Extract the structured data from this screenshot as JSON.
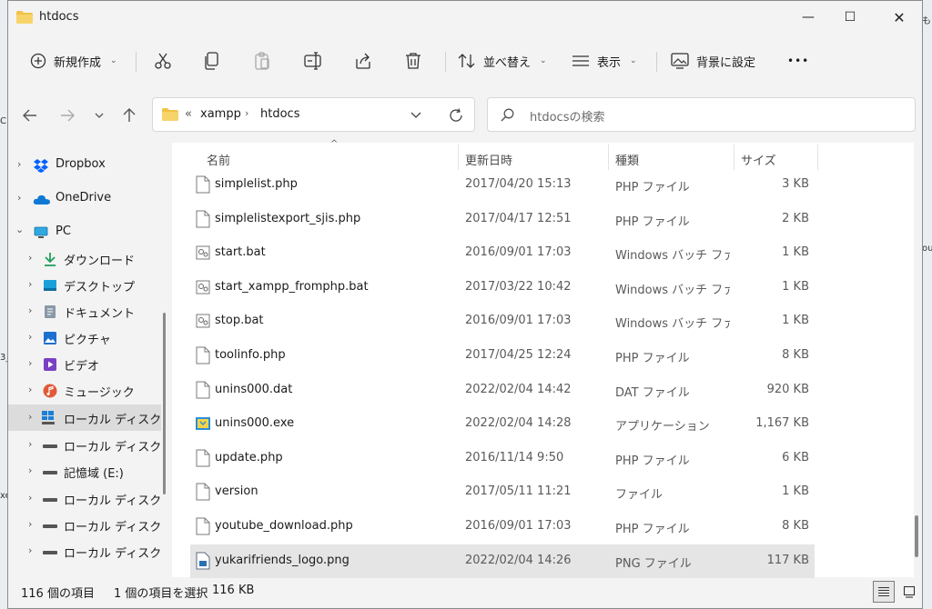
{
  "window": {
    "title": "htdocs",
    "min_glyph": "—",
    "max_glyph": "☐",
    "close_glyph": "✕"
  },
  "toolbar": {
    "new_label": "新規作成",
    "sort_label": "並べ替え",
    "view_label": "表示",
    "wallpaper_label": "背景に設定",
    "more_label": "•••"
  },
  "address": {
    "overflow": "«",
    "crumbs": [
      "xampp",
      "htdocs"
    ]
  },
  "search": {
    "placeholder": "htdocsの検索"
  },
  "nav": {
    "items": [
      {
        "label": "Dropbox",
        "icon": "dropbox-icon"
      },
      {
        "label": "OneDrive",
        "icon": "cloud-icon"
      },
      {
        "label": "PC",
        "icon": "pc-icon"
      },
      {
        "label": "ダウンロード",
        "icon": "download-icon"
      },
      {
        "label": "デスクトップ",
        "icon": "desktop-icon"
      },
      {
        "label": "ドキュメント",
        "icon": "document-icon"
      },
      {
        "label": "ピクチャ",
        "icon": "pictures-icon"
      },
      {
        "label": "ビデオ",
        "icon": "video-icon"
      },
      {
        "label": "ミュージック",
        "icon": "music-icon"
      },
      {
        "label": "ローカル ディスク (C",
        "icon": "windows-drive-icon"
      },
      {
        "label": "ローカル ディスク (D",
        "icon": "drive-icon"
      },
      {
        "label": "記憶域 (E:)",
        "icon": "drive-icon"
      },
      {
        "label": "ローカル ディスク (F",
        "icon": "drive-icon"
      },
      {
        "label": "ローカル ディスク (G",
        "icon": "drive-icon"
      },
      {
        "label": "ローカル ディスク (H",
        "icon": "drive-icon"
      }
    ]
  },
  "columns": {
    "name": "名前",
    "date": "更新日時",
    "type": "種類",
    "size": "サイズ"
  },
  "files": [
    {
      "name": "simplelist.php",
      "date": "2017/04/20 15:13",
      "type": "PHP ファイル",
      "size": "3 KB",
      "icon": "file-icon"
    },
    {
      "name": "simplelistexport_sjis.php",
      "date": "2017/04/17 12:51",
      "type": "PHP ファイル",
      "size": "2 KB",
      "icon": "file-icon"
    },
    {
      "name": "start.bat",
      "date": "2016/09/01 17:03",
      "type": "Windows バッチ ファ...",
      "size": "1 KB",
      "icon": "batch-file-icon"
    },
    {
      "name": "start_xampp_fromphp.bat",
      "date": "2017/03/22 10:42",
      "type": "Windows バッチ ファ...",
      "size": "1 KB",
      "icon": "batch-file-icon"
    },
    {
      "name": "stop.bat",
      "date": "2016/09/01 17:03",
      "type": "Windows バッチ ファ...",
      "size": "1 KB",
      "icon": "batch-file-icon"
    },
    {
      "name": "toolinfo.php",
      "date": "2017/04/25 12:24",
      "type": "PHP ファイル",
      "size": "8 KB",
      "icon": "file-icon"
    },
    {
      "name": "unins000.dat",
      "date": "2022/02/04 14:42",
      "type": "DAT ファイル",
      "size": "920 KB",
      "icon": "file-icon"
    },
    {
      "name": "unins000.exe",
      "date": "2022/02/04 14:28",
      "type": "アプリケーション",
      "size": "1,167 KB",
      "icon": "app-icon"
    },
    {
      "name": "update.php",
      "date": "2016/11/14 9:50",
      "type": "PHP ファイル",
      "size": "6 KB",
      "icon": "file-icon"
    },
    {
      "name": "version",
      "date": "2017/05/11 11:21",
      "type": "ファイル",
      "size": "1 KB",
      "icon": "file-icon"
    },
    {
      "name": "youtube_download.php",
      "date": "2016/09/01 17:03",
      "type": "PHP ファイル",
      "size": "8 KB",
      "icon": "file-icon"
    },
    {
      "name": "yukarifriends_logo.png",
      "date": "2022/02/04 14:26",
      "type": "PNG ファイル",
      "size": "117 KB",
      "icon": "image-file-icon",
      "selected": true
    }
  ],
  "status": {
    "item_count": "116 個の項目",
    "selection": "1 個の項目を選択",
    "selection_size": "116 KB"
  },
  "desktop_chars": {
    "top_right": "も",
    "right_mid": "ou",
    "left_a": "C",
    "left_b": "3_",
    "left_c": "xe"
  },
  "colors": {
    "accent": "#0067c0",
    "folder": "#f0c246",
    "selected_row": "#e5e5e5"
  }
}
